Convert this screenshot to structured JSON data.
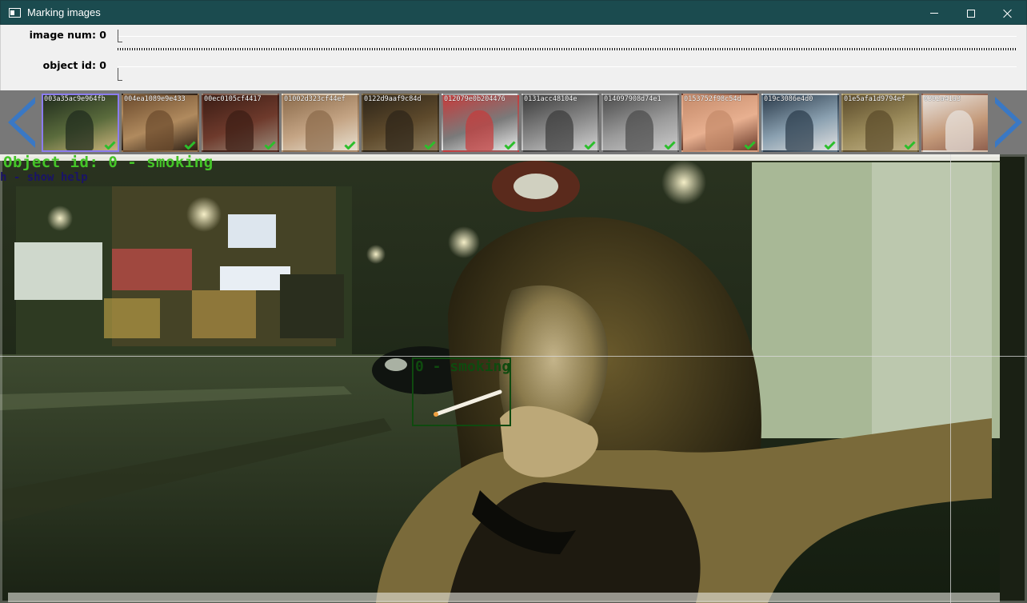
{
  "window": {
    "title": "Marking images"
  },
  "trackbars": {
    "image_num": {
      "label": "image num: 0",
      "value": 0
    },
    "object_id": {
      "label": "object id: 0",
      "value": 0
    }
  },
  "thumbnails": [
    {
      "name": "003a35ac9e964fb",
      "marked": true,
      "selected": true,
      "colors": [
        "#1e2a1c",
        "#5a6b3c",
        "#c9b27a"
      ]
    },
    {
      "name": "004ea1089e9e433",
      "marked": true,
      "selected": false,
      "colors": [
        "#6b4a2c",
        "#b08a5e",
        "#2e1f14"
      ]
    },
    {
      "name": "00ec0105cf4417",
      "marked": true,
      "selected": false,
      "colors": [
        "#3a1c14",
        "#6e3a2c",
        "#9a8a7a"
      ]
    },
    {
      "name": "01002d323cf44ef",
      "marked": true,
      "selected": false,
      "colors": [
        "#8a6a4a",
        "#c4a484",
        "#e8e0d0"
      ]
    },
    {
      "name": "0122d9aaf9c84d",
      "marked": true,
      "selected": false,
      "colors": [
        "#2c2418",
        "#5e4a2c",
        "#8a7a5a"
      ]
    },
    {
      "name": "012079e0b204476",
      "marked": true,
      "selected": false,
      "colors": [
        "#c83a3a",
        "#7a7a7a",
        "#e8e8e8"
      ]
    },
    {
      "name": "0131acc48104e",
      "marked": true,
      "selected": false,
      "colors": [
        "#3a3a3a",
        "#8a8a8a",
        "#d0d0d0"
      ]
    },
    {
      "name": "014097908d74e1",
      "marked": true,
      "selected": false,
      "colors": [
        "#4a4a4a",
        "#9a9a9a",
        "#cacaca"
      ]
    },
    {
      "name": "0153752f98c54d",
      "marked": true,
      "selected": false,
      "colors": [
        "#c48a6a",
        "#e8b090",
        "#6a3a2a"
      ]
    },
    {
      "name": "019c3086e4d0",
      "marked": true,
      "selected": false,
      "colors": [
        "#2a3a4a",
        "#8aa0b0",
        "#e0e0e0"
      ]
    },
    {
      "name": "01e5afa1d9794ef",
      "marked": true,
      "selected": false,
      "colors": [
        "#5a4a2a",
        "#9a8a5a",
        "#c4b48a"
      ]
    },
    {
      "name": "0392a41a3",
      "marked": false,
      "selected": false,
      "colors": [
        "#e8e4e0",
        "#c49a7a",
        "#8a5a4a"
      ]
    }
  ],
  "overlay": {
    "object_label": "Object id: 0  - smoking",
    "help_label": "h - show help",
    "bbox_label": "0 - smoking"
  },
  "icons": {
    "prev": "triangle-left-icon",
    "next": "triangle-right-icon",
    "check": "checkmark-icon"
  },
  "colors": {
    "titlebar": "#1b4b4f",
    "label_green": "#44c428",
    "bbox_green": "#0f4a0f",
    "help_blue": "#1a1466",
    "arrow_blue": "#3a78c4",
    "check_green": "#2bbf2b"
  }
}
